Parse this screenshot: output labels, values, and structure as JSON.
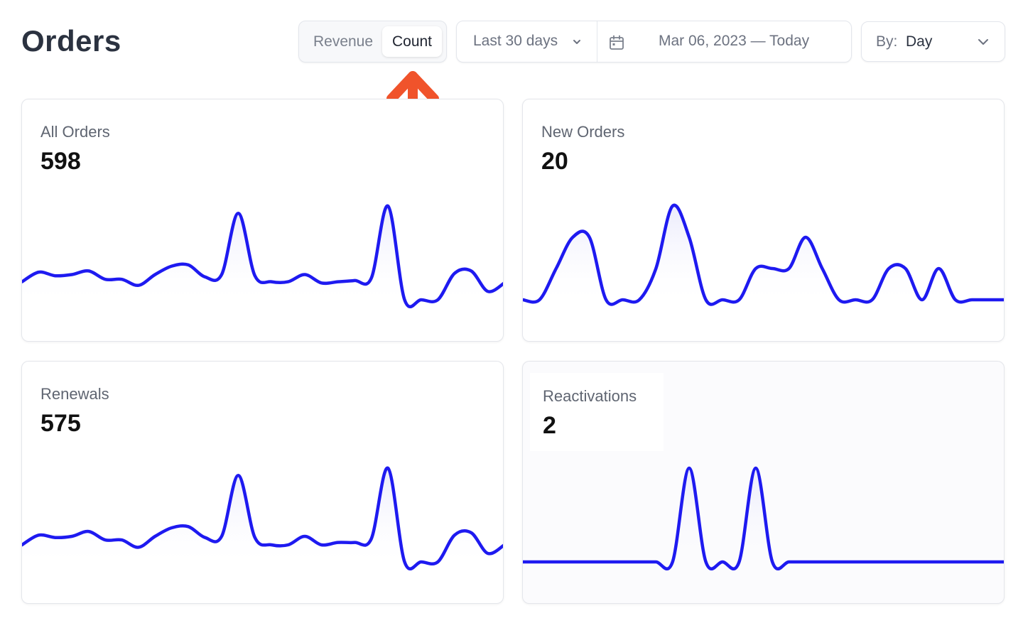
{
  "page": {
    "title": "Orders"
  },
  "toggle": {
    "revenue_label": "Revenue",
    "count_label": "Count",
    "selected": "Count"
  },
  "date_range": {
    "preset_label": "Last 30 days",
    "range_text": "Mar 06, 2023 — Today",
    "calendar_icon": "calendar-icon",
    "chevron_icon": "chevron-down-icon"
  },
  "group_by": {
    "label": "By:",
    "value": "Day",
    "chevron_icon": "chevron-down-icon"
  },
  "annotation": {
    "icon": "arrow-up-icon",
    "color": "#f0532b"
  },
  "colors": {
    "line": "#1e1af0",
    "fill_top": "#e8e8fb",
    "text": "#2b3240"
  },
  "cards": [
    {
      "id": "all-orders",
      "label": "All Orders",
      "value": "598",
      "series": [
        25,
        33,
        30,
        31,
        34,
        27,
        27,
        22,
        31,
        38,
        39,
        29,
        31,
        82,
        30,
        25,
        25,
        31,
        24,
        25,
        26,
        28,
        88,
        10,
        10,
        10,
        32,
        34,
        17,
        24
      ]
    },
    {
      "id": "new-orders",
      "label": "New Orders",
      "value": "20",
      "series": [
        0,
        0,
        1,
        2,
        2,
        0,
        0,
        0,
        1,
        3,
        2,
        0,
        0,
        0,
        1,
        1,
        1,
        2,
        1,
        0,
        0,
        0,
        1,
        1,
        0,
        1,
        0,
        0,
        0,
        0
      ]
    },
    {
      "id": "renewals",
      "label": "Renewals",
      "value": "575",
      "series": [
        24,
        32,
        30,
        31,
        35,
        28,
        28,
        22,
        31,
        38,
        39,
        30,
        31,
        81,
        30,
        24,
        24,
        31,
        24,
        26,
        26,
        29,
        87,
        10,
        10,
        10,
        32,
        34,
        17,
        24
      ]
    },
    {
      "id": "reactivations",
      "label": "Reactivations",
      "value": "2",
      "series": [
        0,
        0,
        0,
        0,
        0,
        0,
        0,
        0,
        0,
        0,
        1,
        0,
        0,
        0,
        1,
        0,
        0,
        0,
        0,
        0,
        0,
        0,
        0,
        0,
        0,
        0,
        0,
        0,
        0,
        0
      ]
    }
  ]
}
